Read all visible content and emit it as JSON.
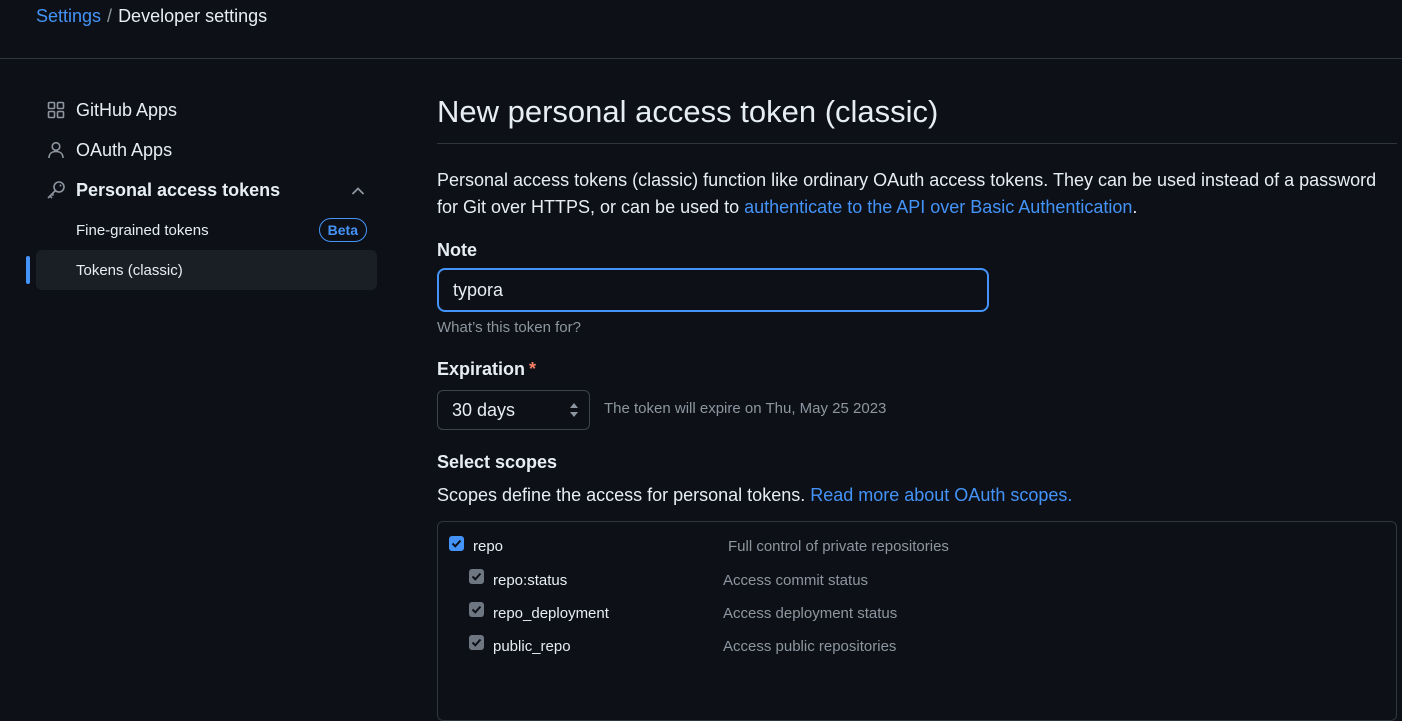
{
  "breadcrumb": {
    "settings": "Settings",
    "separator": "/",
    "current": "Developer settings"
  },
  "sidebar": {
    "items": [
      {
        "label": "GitHub Apps",
        "icon": "apps-grid-icon"
      },
      {
        "label": "OAuth Apps",
        "icon": "person-icon"
      },
      {
        "label": "Personal access tokens",
        "icon": "key-icon",
        "expanded": true
      }
    ],
    "sub_items": [
      {
        "label": "Fine-grained tokens",
        "badge": "Beta"
      },
      {
        "label": "Tokens (classic)",
        "active": true
      }
    ]
  },
  "main": {
    "title": "New personal access token (classic)",
    "description_part1": "Personal access tokens (classic) function like ordinary OAuth access tokens. They can be used instead of a password for Git over HTTPS, or can be used to ",
    "description_link": "authenticate to the API over Basic Authentication",
    "description_end": ".",
    "note": {
      "label": "Note",
      "value": "typora",
      "help": "What’s this token for?"
    },
    "expiration": {
      "label": "Expiration",
      "required_mark": "*",
      "selected": "30 days",
      "note": "The token will expire on Thu, May 25 2023"
    },
    "scopes": {
      "label": "Select scopes",
      "description": "Scopes define the access for personal tokens. ",
      "link": "Read more about OAuth scopes.",
      "rows": [
        {
          "name": "repo",
          "description": "Full control of private repositories",
          "checked": true,
          "level": 0
        },
        {
          "name": "repo:status",
          "description": "Access commit status",
          "checked": true,
          "level": 1
        },
        {
          "name": "repo_deployment",
          "description": "Access deployment status",
          "checked": true,
          "level": 1
        },
        {
          "name": "public_repo",
          "description": "Access public repositories",
          "checked": true,
          "level": 1
        }
      ]
    }
  },
  "colors": {
    "background": "#0d1117",
    "link": "#4493f8",
    "muted_text": "#8d96a0",
    "border": "#30363d",
    "required": "#f78166"
  }
}
